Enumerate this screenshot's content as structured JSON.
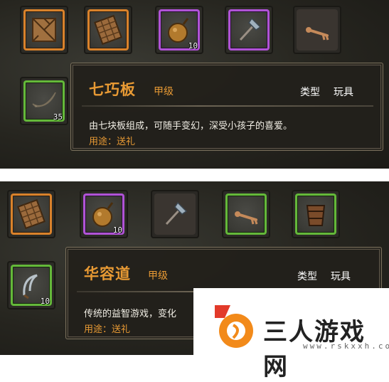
{
  "top": {
    "slots": [
      {
        "icon": "tangram-icon",
        "rarity": "orange"
      },
      {
        "icon": "chocolate-board-icon",
        "rarity": "orange"
      },
      {
        "icon": "gourd-icon",
        "rarity": "purple",
        "count": "10"
      },
      {
        "icon": "axe-icon",
        "rarity": "purple"
      },
      {
        "icon": "bone-key-icon",
        "rarity": "dim"
      },
      {
        "icon": "fang-icon",
        "rarity": "green",
        "count": "35"
      }
    ],
    "tooltip": {
      "name": "七巧板",
      "grade": "甲级",
      "type_label": "类型",
      "type_value": "玩具",
      "description": "由七块板组成，可随手变幻，深受小孩子的喜爱。",
      "usage": "用途：送礼"
    }
  },
  "bottom": {
    "slots": [
      {
        "icon": "chocolate-board-icon",
        "rarity": "orange"
      },
      {
        "icon": "gourd-icon",
        "rarity": "purple",
        "count": "10"
      },
      {
        "icon": "axe-icon",
        "rarity": "dim"
      },
      {
        "icon": "bone-key-icon",
        "rarity": "green"
      },
      {
        "icon": "wooden-bucket-icon",
        "rarity": "green"
      },
      {
        "icon": "sickle-icon",
        "rarity": "green",
        "count": "10"
      }
    ],
    "tooltip": {
      "name": "华容道",
      "grade": "甲级",
      "type_label": "类型",
      "type_value": "玩具",
      "description": "传统的益智游戏，变化"
    },
    "usage": "用途：送礼"
  },
  "watermark": {
    "brand": "三人游戏网",
    "url": "www.rskxxh.com"
  },
  "colors": {
    "orange_frame": "#d9822b",
    "purple_frame": "#b053d6",
    "green_frame": "#64b83a",
    "item_name": "#e89a34"
  }
}
